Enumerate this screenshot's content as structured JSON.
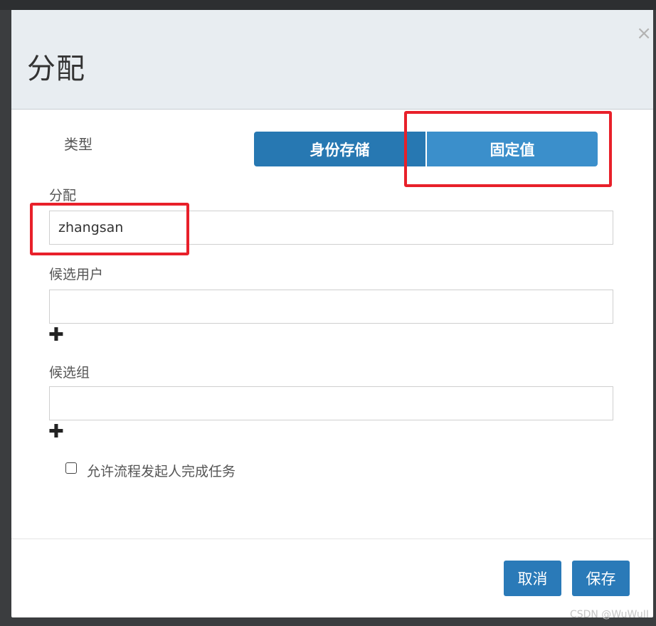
{
  "dialog": {
    "title": "分配",
    "close_glyph": "×"
  },
  "type_row": {
    "label": "类型",
    "options": [
      "身份存储",
      "固定值"
    ],
    "selected": "固定值"
  },
  "assignee": {
    "label": "分配",
    "value": "zhangsan"
  },
  "candidate_users": {
    "label": "候选用户",
    "value": "",
    "add_glyph": "✚"
  },
  "candidate_groups": {
    "label": "候选组",
    "value": "",
    "add_glyph": "✚"
  },
  "allow_initiator": {
    "label": "允许流程发起人完成任务",
    "checked": false
  },
  "footer": {
    "cancel_label": "取消",
    "save_label": "保存"
  },
  "watermark": "CSDN @WuWuII",
  "colors": {
    "primary_button": "#2a7ab8",
    "segment_identity": "#2778b2",
    "segment_fixed": "#3b8fcb",
    "highlight_box": "#e8202a",
    "header_bg": "#e8edf1"
  }
}
